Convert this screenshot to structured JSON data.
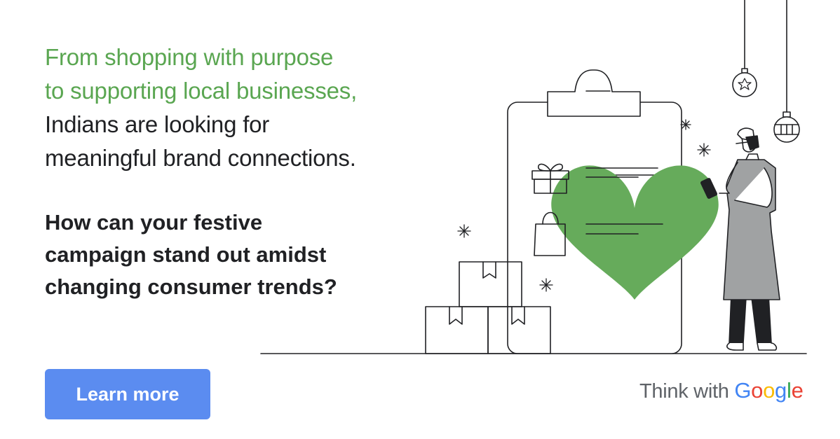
{
  "headline": {
    "green_lines": [
      "From shopping with purpose",
      "to supporting local businesses,"
    ],
    "dark_lines": [
      "Indians are looking for",
      "meaningful brand connections."
    ]
  },
  "question": {
    "lines": [
      "How can your festive",
      "campaign stand out amidst",
      "changing consumer trends?"
    ]
  },
  "cta": {
    "label": "Learn more"
  },
  "brand": {
    "prefix": "Think with",
    "google": [
      {
        "letter": "G",
        "color": "#4285F4"
      },
      {
        "letter": "o",
        "color": "#EA4335"
      },
      {
        "letter": "o",
        "color": "#FBBC05"
      },
      {
        "letter": "g",
        "color": "#4285F4"
      },
      {
        "letter": "l",
        "color": "#34A853"
      },
      {
        "letter": "e",
        "color": "#EA4335"
      }
    ]
  },
  "colors": {
    "accent_green": "#5aa651",
    "heart_green": "#66ab5b",
    "button_blue": "#5b8cf0",
    "text_dark": "#202124",
    "text_gray": "#5f6368"
  }
}
